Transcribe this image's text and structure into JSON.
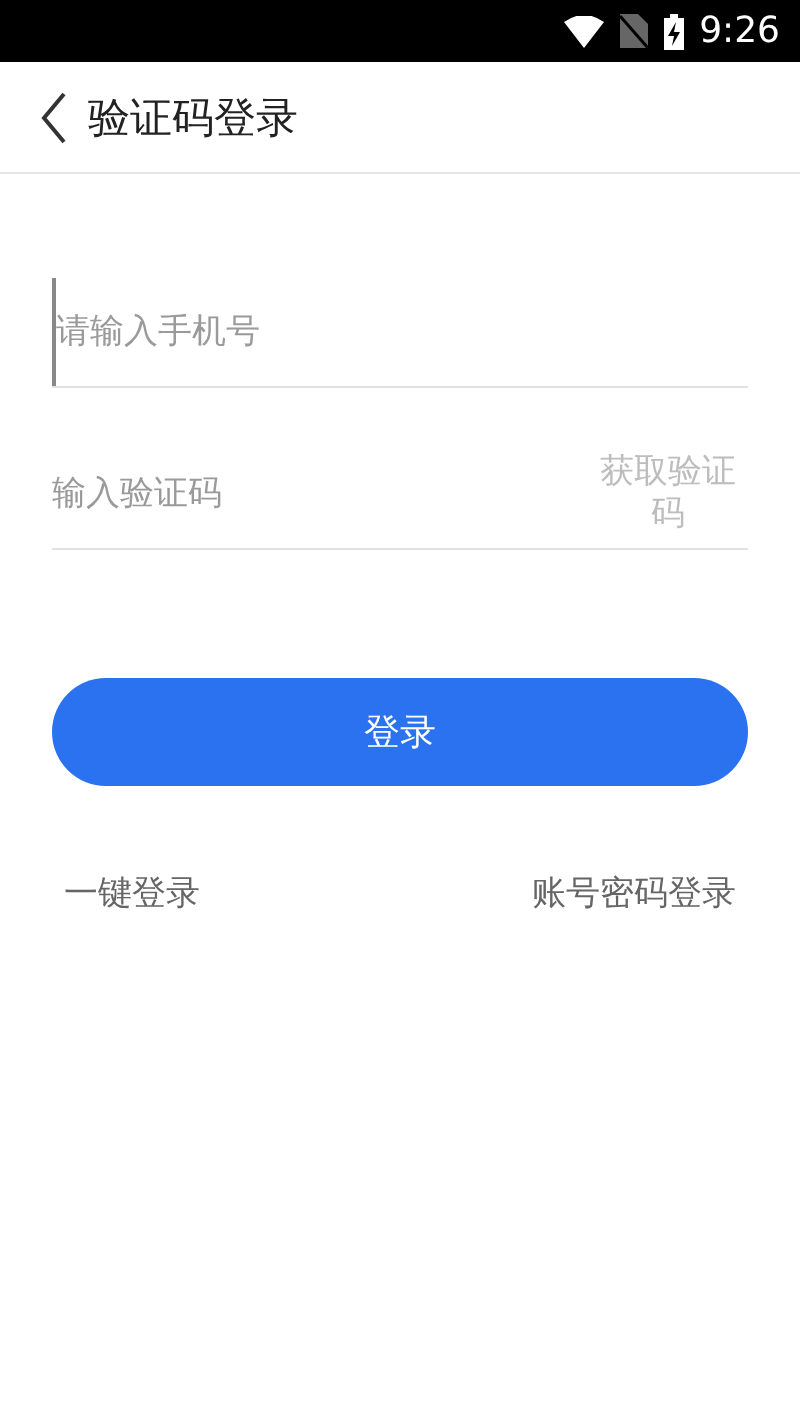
{
  "status_bar": {
    "time": "9:26"
  },
  "header": {
    "title": "验证码登录"
  },
  "phone_field": {
    "placeholder": "请输入手机号",
    "focused": true
  },
  "code_field": {
    "placeholder": "输入验证码",
    "action": "获取验证码",
    "action_disabled": true
  },
  "login_button": {
    "label": "登录"
  },
  "links": [
    "一键登录",
    "账号密码登录"
  ]
}
